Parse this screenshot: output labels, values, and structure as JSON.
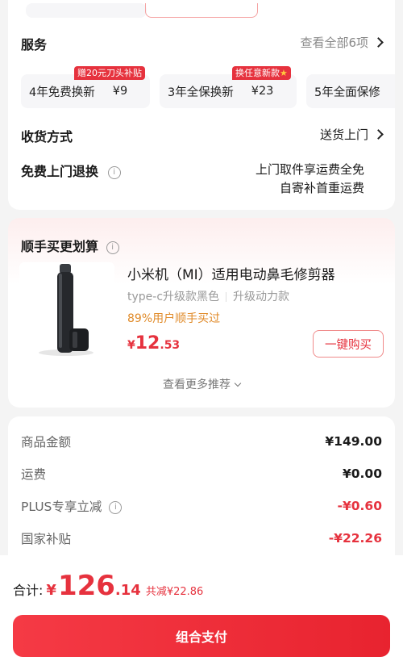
{
  "service": {
    "title": "服务",
    "view_all": "查看全部6项",
    "options": [
      {
        "name": "4年免费换新",
        "price": "¥9",
        "tag": "赠20元刀头补贴"
      },
      {
        "name": "3年全保换新",
        "price": "¥23",
        "tag": "换任意新款"
      },
      {
        "name": "5年全面保修",
        "price": "",
        "tag": ""
      }
    ]
  },
  "delivery": {
    "label": "收货方式",
    "value": "送货上门"
  },
  "returns": {
    "label": "免费上门退换",
    "line1": "上门取件享运费全免",
    "line2": "自寄补首重运费"
  },
  "recommend": {
    "title": "顺手买更划算",
    "product": {
      "name": "小米机（MI）适用电动鼻毛修剪器",
      "spec1": "type-c升级款黑色",
      "spec2": "升级动力款",
      "pct": "89%用户顺手买过",
      "price_symbol": "¥",
      "price_int": "12",
      "price_dec": ".53",
      "buy_label": "一键购买"
    },
    "more_label": "查看更多推荐"
  },
  "summary": {
    "rows": [
      {
        "label": "商品金额",
        "value": "¥149.00"
      },
      {
        "label": "运费",
        "value": "¥0.00"
      },
      {
        "label": "PLUS专享立减",
        "value": "-¥0.60"
      },
      {
        "label": "国家补贴",
        "value": "-¥22.26"
      }
    ]
  },
  "footer": {
    "total_label": "合计:",
    "symbol": "¥",
    "total_int": "126",
    "total_dec": ".14",
    "saved": "共减¥22.86",
    "pay_label": "组合支付"
  },
  "colors": {
    "accent": "#e6323e",
    "orange": "#e08a28"
  }
}
